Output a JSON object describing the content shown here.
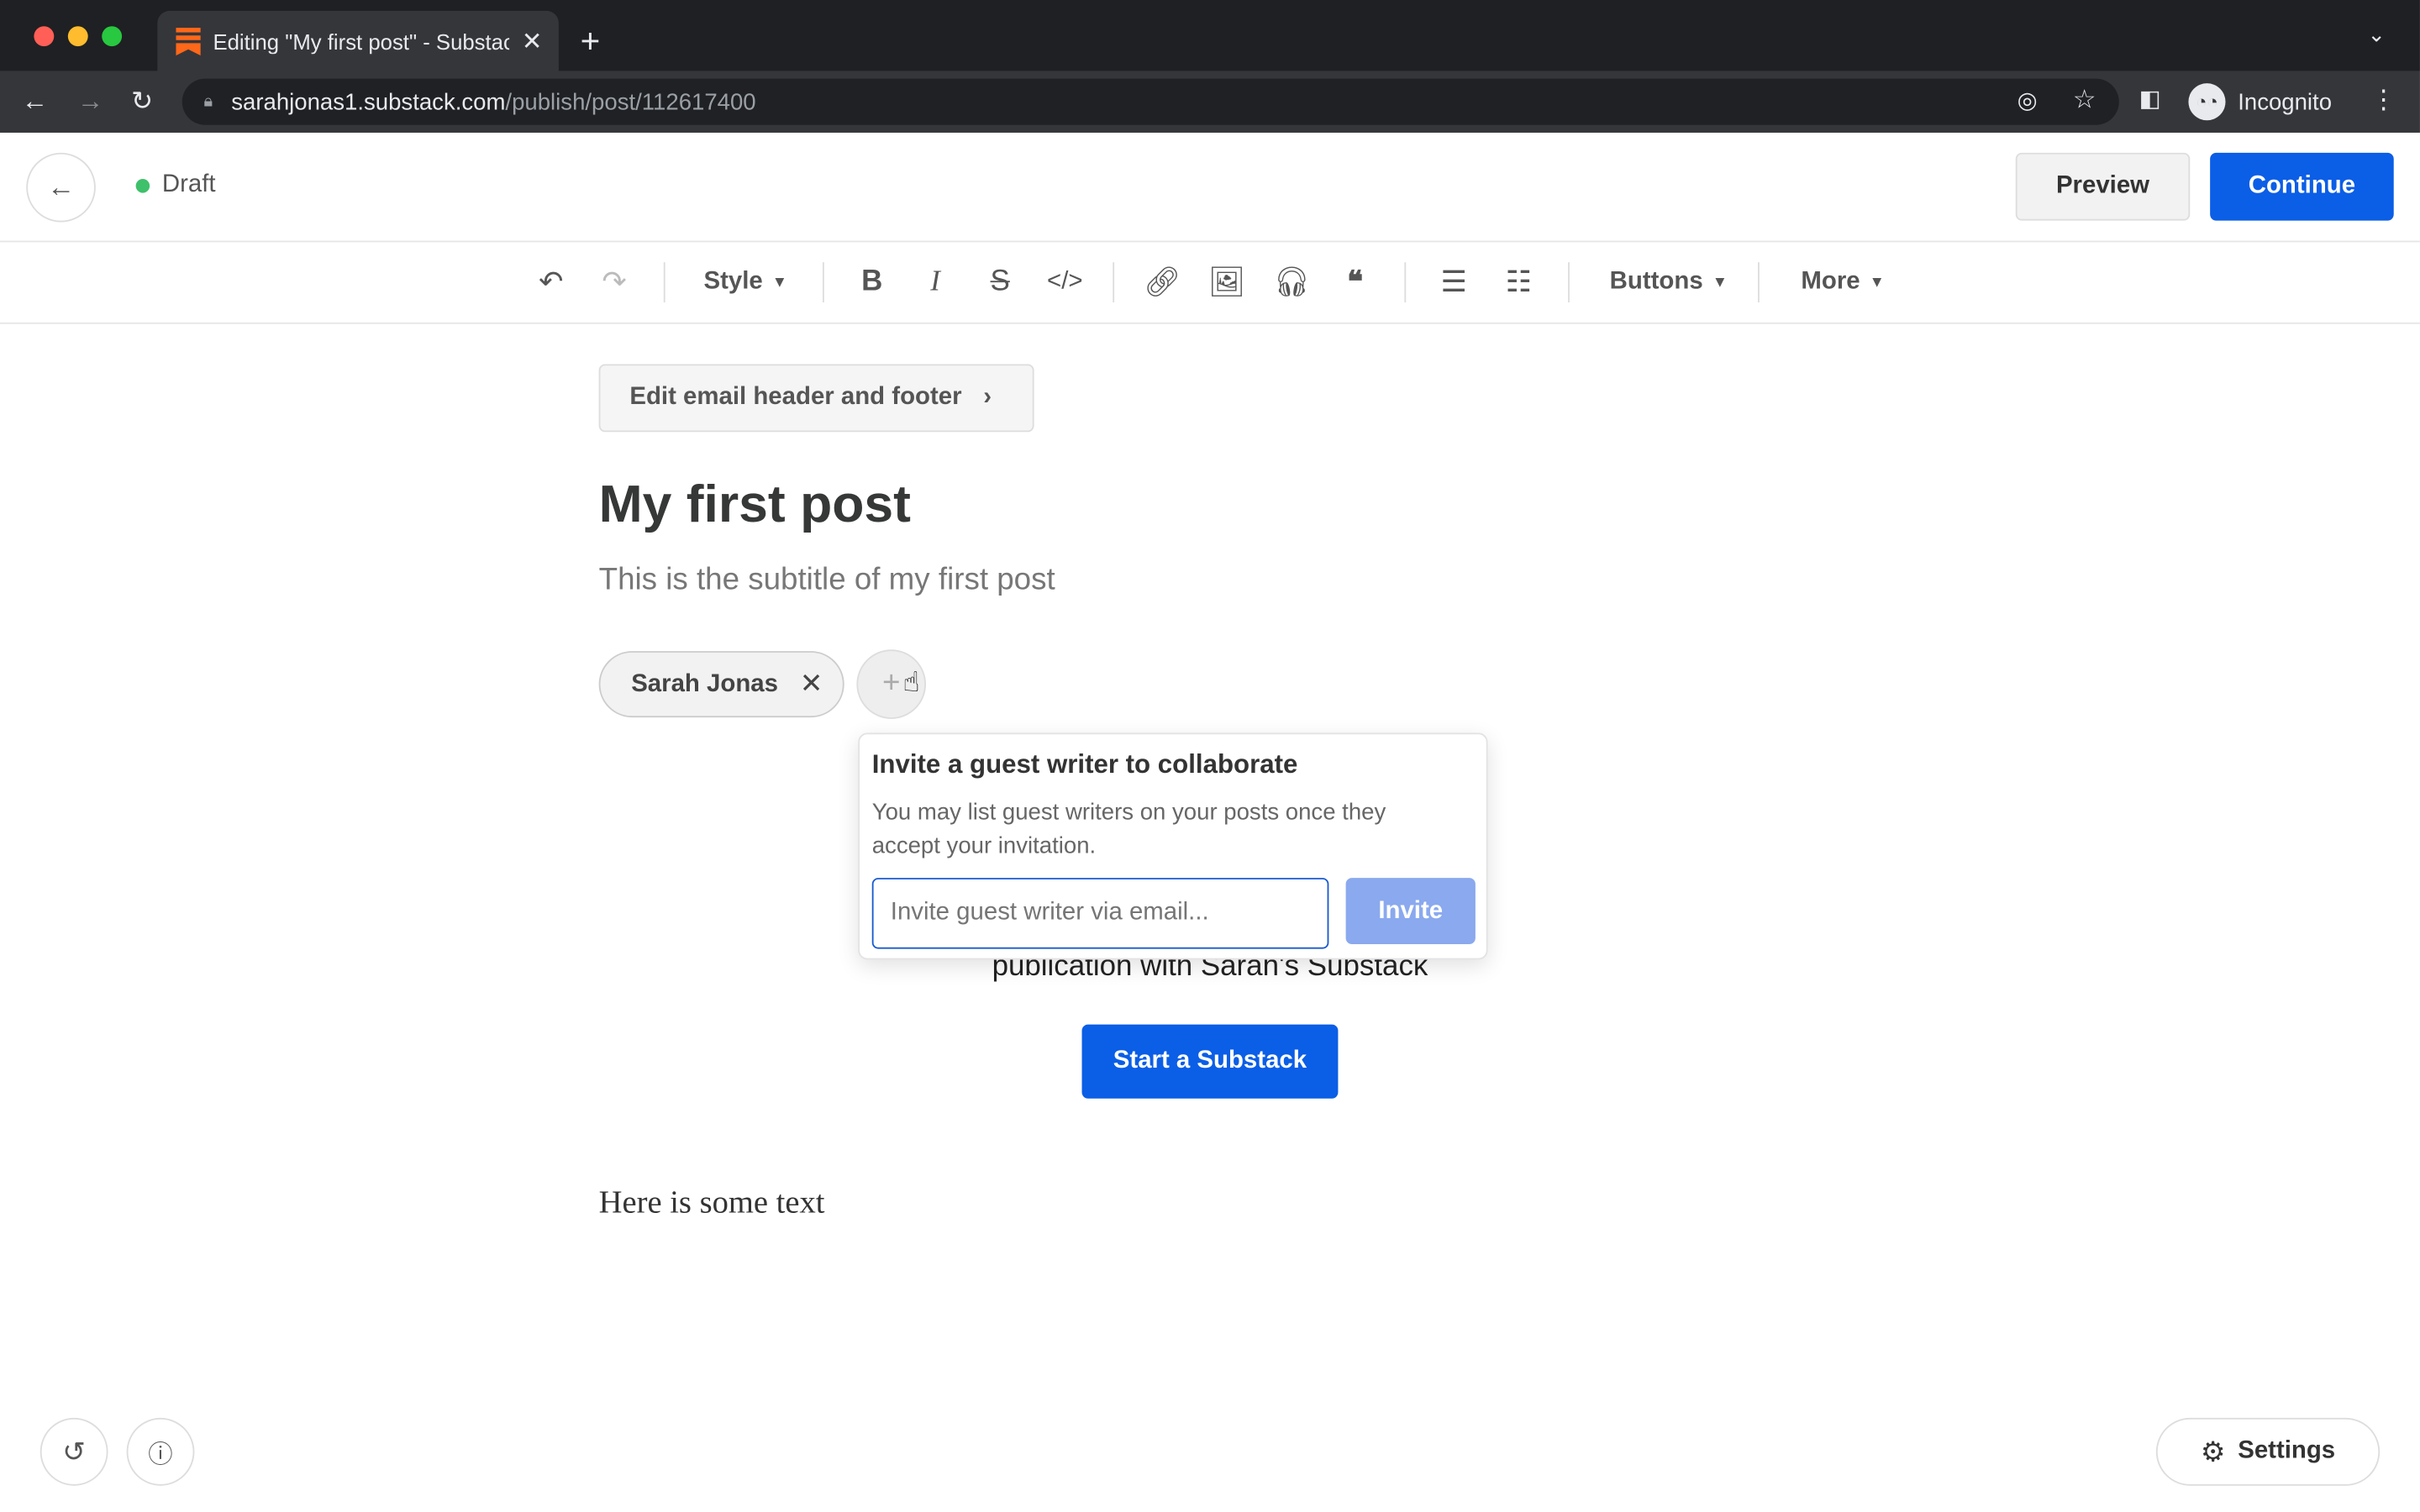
{
  "browser": {
    "tab_title": "Editing \"My first post\" - Substack",
    "url_host": "sarahjonas1.substack.com",
    "url_path": "/publish/post/112617400",
    "profile_label": "Incognito"
  },
  "header": {
    "status": "Draft",
    "status_color": "#3fc06a",
    "preview_label": "Preview",
    "continue_label": "Continue",
    "accent": "#0b5ee6"
  },
  "toolbar": {
    "style_label": "Style",
    "buttons_label": "Buttons",
    "more_label": "More"
  },
  "editor": {
    "email_header_label": "Edit email header and footer",
    "title": "My first post",
    "subtitle": "This is the subtitle of my first post",
    "author_chip": "Sarah Jonas",
    "embed_partial_char": "o",
    "embed_text": "publication with Sarah's Substack",
    "embed_button": "Start a Substack",
    "body_text": "Here is some text"
  },
  "popover": {
    "title": "Invite a guest writer to collaborate",
    "description": "You may list guest writers on your posts once they accept your invitation.",
    "email_placeholder": "Invite guest writer via email...",
    "invite_label": "Invite"
  },
  "footer": {
    "settings_label": "Settings"
  }
}
